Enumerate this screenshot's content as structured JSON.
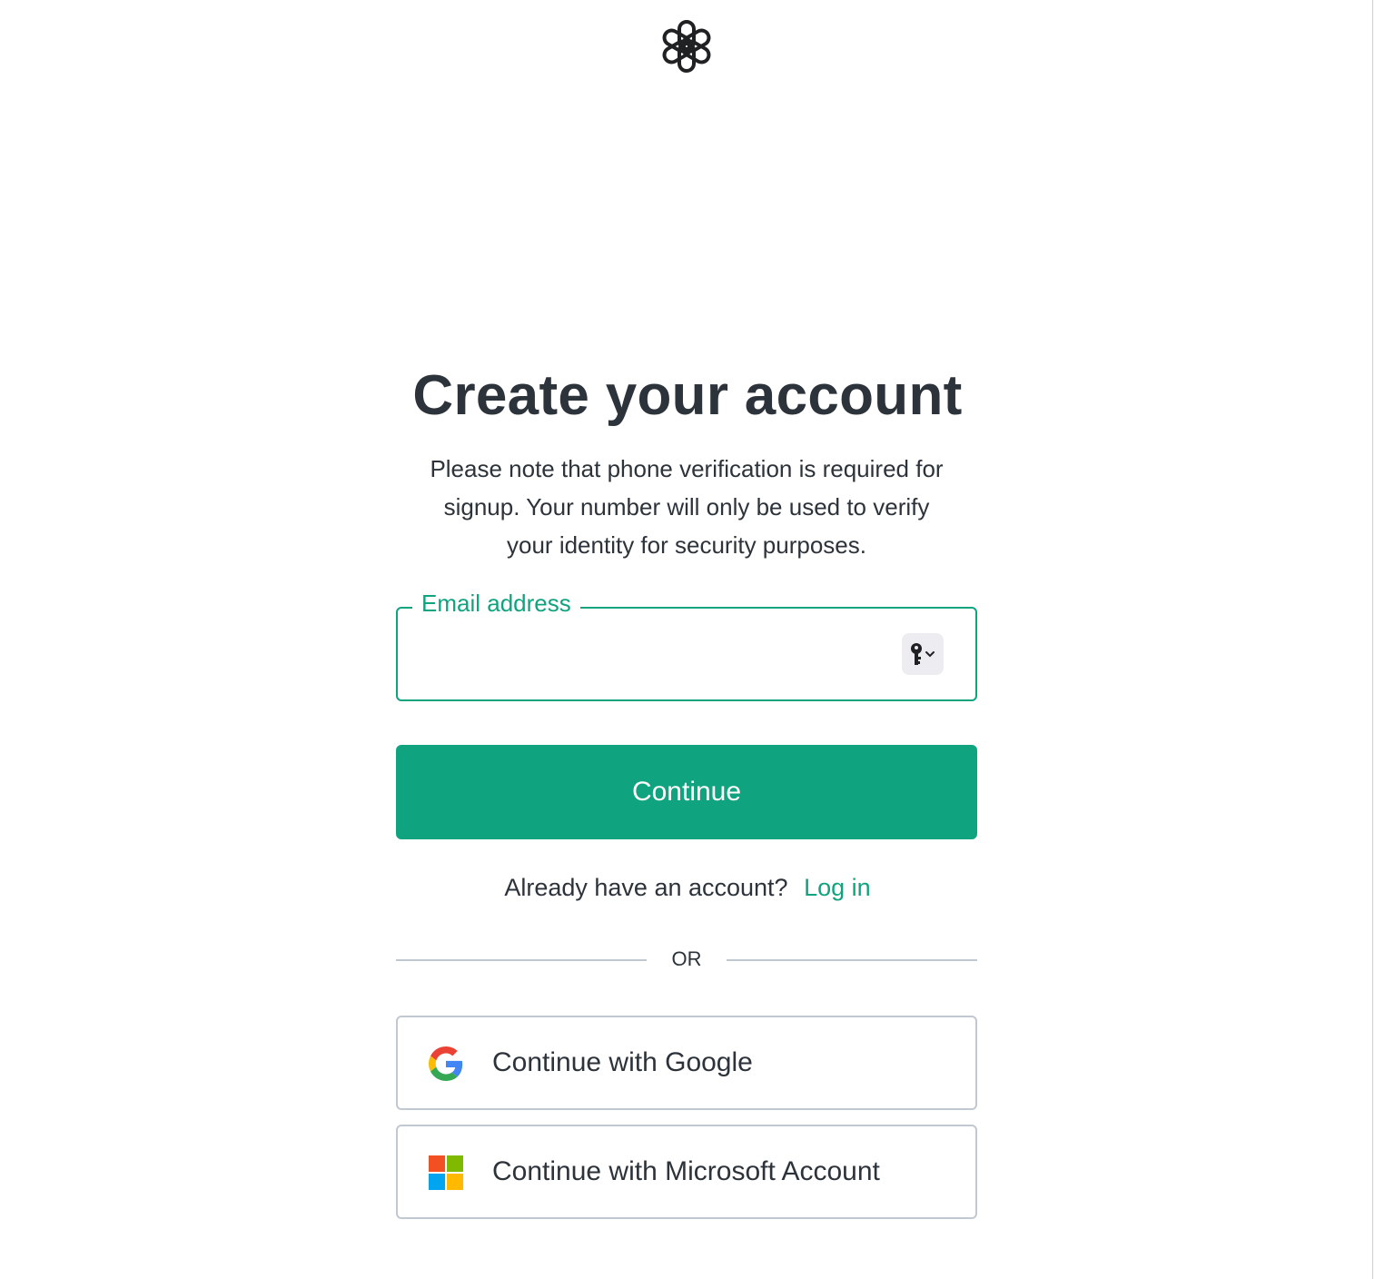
{
  "header": {
    "logo_icon": "openai-logo-icon"
  },
  "main": {
    "title": "Create your account",
    "subtitle_lines": [
      "Please note that phone verification is required for",
      "signup. Your number will only be used to verify",
      "your identity for security purposes."
    ],
    "email": {
      "label": "Email address",
      "value": "",
      "placeholder": "",
      "autofill_icon": "key-icon",
      "autofill_chevron": "chevron-down-icon"
    },
    "continue_label": "Continue",
    "login": {
      "prompt": "Already have an account?",
      "link_label": "Log in"
    },
    "divider_label": "OR",
    "social": {
      "google_label": "Continue with Google",
      "google_icon": "google-icon",
      "microsoft_label": "Continue with Microsoft Account",
      "microsoft_icon": "microsoft-icon"
    }
  },
  "colors": {
    "accent": "#10a37f",
    "text": "#2d333a",
    "border": "#c2c8d0",
    "key_button_bg": "#ececf1",
    "google_blue": "#4285F4",
    "google_red": "#EA4335",
    "google_yellow": "#FBBC05",
    "google_green": "#34A853",
    "ms_red": "#F25022",
    "ms_green": "#7FBA00",
    "ms_blue": "#00A4EF",
    "ms_yellow": "#FFB900"
  }
}
